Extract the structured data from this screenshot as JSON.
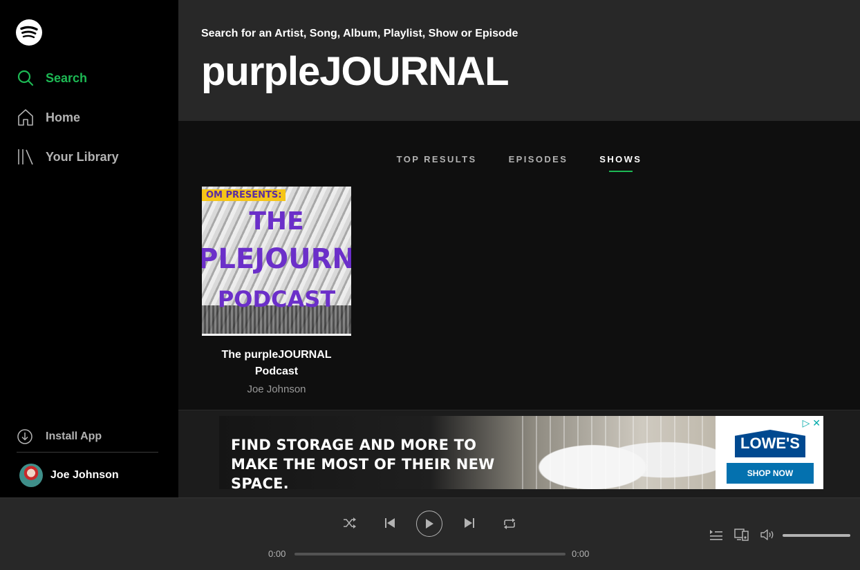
{
  "sidebar": {
    "nav": [
      {
        "label": "Search",
        "icon": "search-icon",
        "active": true
      },
      {
        "label": "Home",
        "icon": "home-icon",
        "active": false
      },
      {
        "label": "Your Library",
        "icon": "library-icon",
        "active": false
      }
    ],
    "install_label": "Install App",
    "user_name": "Joe Johnson"
  },
  "header": {
    "hint": "Search for an Artist, Song, Album, Playlist, Show or Episode",
    "query": "purpleJOURNAL"
  },
  "tabs": [
    {
      "label": "TOP RESULTS",
      "active": false
    },
    {
      "label": "EPISODES",
      "active": false
    },
    {
      "label": "SHOWS",
      "active": true
    }
  ],
  "results": [
    {
      "title": "The purpleJOURNAL Podcast",
      "subtitle": "Joe Johnson",
      "cover": {
        "banner": "OM PRESENTS:",
        "line1": "THE",
        "line2": "PLEJOURN",
        "line3": "PODCAST"
      }
    }
  ],
  "ad": {
    "headline": "FIND STORAGE AND MORE TO MAKE THE MOST OF THEIR NEW SPACE.",
    "brand": "LOWE'S",
    "cta": "SHOP NOW",
    "icons": "▷ ✕"
  },
  "player": {
    "elapsed": "0:00",
    "duration": "0:00",
    "progress": 0,
    "volume": 1.0
  },
  "colors": {
    "accent": "#1db954",
    "sidebar_bg": "#000000",
    "header_bg": "#282828",
    "main_bg": "#0f0f0f",
    "player_bg": "#282828",
    "cover_text": "#6b2fc9"
  }
}
